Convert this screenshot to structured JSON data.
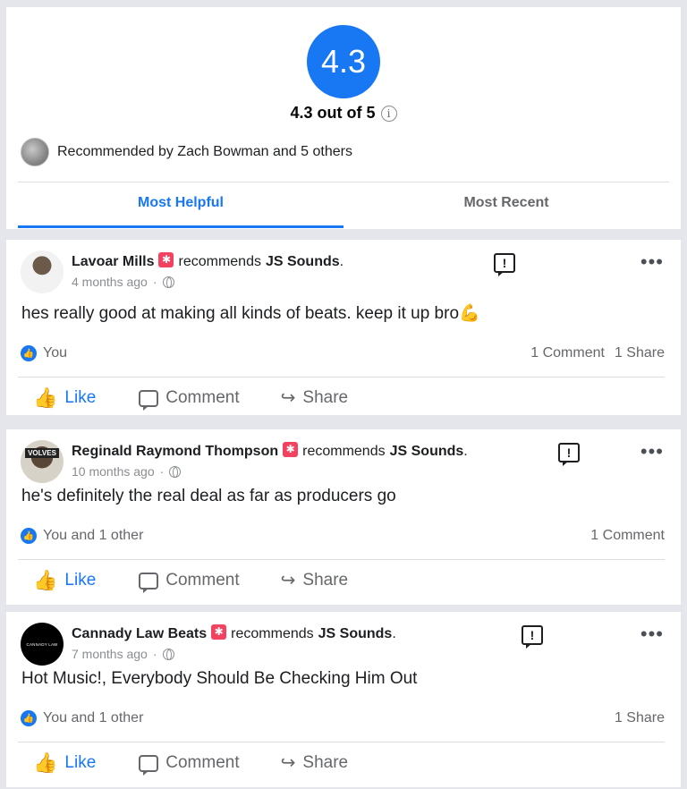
{
  "summary": {
    "score": "4.3",
    "score_text": "4.3 out of 5",
    "info_symbol": "i",
    "recommended_text": "Recommended by Zach Bowman and 5 others",
    "tabs": [
      {
        "label": "Most Helpful",
        "active": true
      },
      {
        "label": "Most Recent",
        "active": false
      }
    ]
  },
  "colors": {
    "accent": "#1877f2",
    "badge": "#f3425f",
    "muted": "#65676b"
  },
  "actions": {
    "like": "Like",
    "comment": "Comment",
    "share": "Share"
  },
  "reviews": [
    {
      "author": "Lavoar Mills",
      "verb": "recommends",
      "page": "JS Sounds",
      "time": "4 months ago",
      "text": "hes really good at making all kinds of beats. keep it up bro💪",
      "reactions": "You",
      "comments": "1 Comment",
      "shares": "1 Share"
    },
    {
      "author": "Reginald Raymond Thompson",
      "verb": "recommends",
      "page": "JS Sounds",
      "time": "10 months ago",
      "text": "he's definitely the real deal as far as producers go",
      "reactions": "You and 1 other",
      "comments": "1 Comment",
      "shares": "",
      "avatar_text": "VOLVES"
    },
    {
      "author": "Cannady Law Beats",
      "verb": "recommends",
      "page": "JS Sounds",
      "time": "7 months ago",
      "text": "Hot Music!, Everybody Should Be Checking Him Out",
      "reactions": "You and 1 other",
      "comments": "",
      "shares": "1 Share",
      "avatar_text": "CANNADY LAW"
    }
  ]
}
